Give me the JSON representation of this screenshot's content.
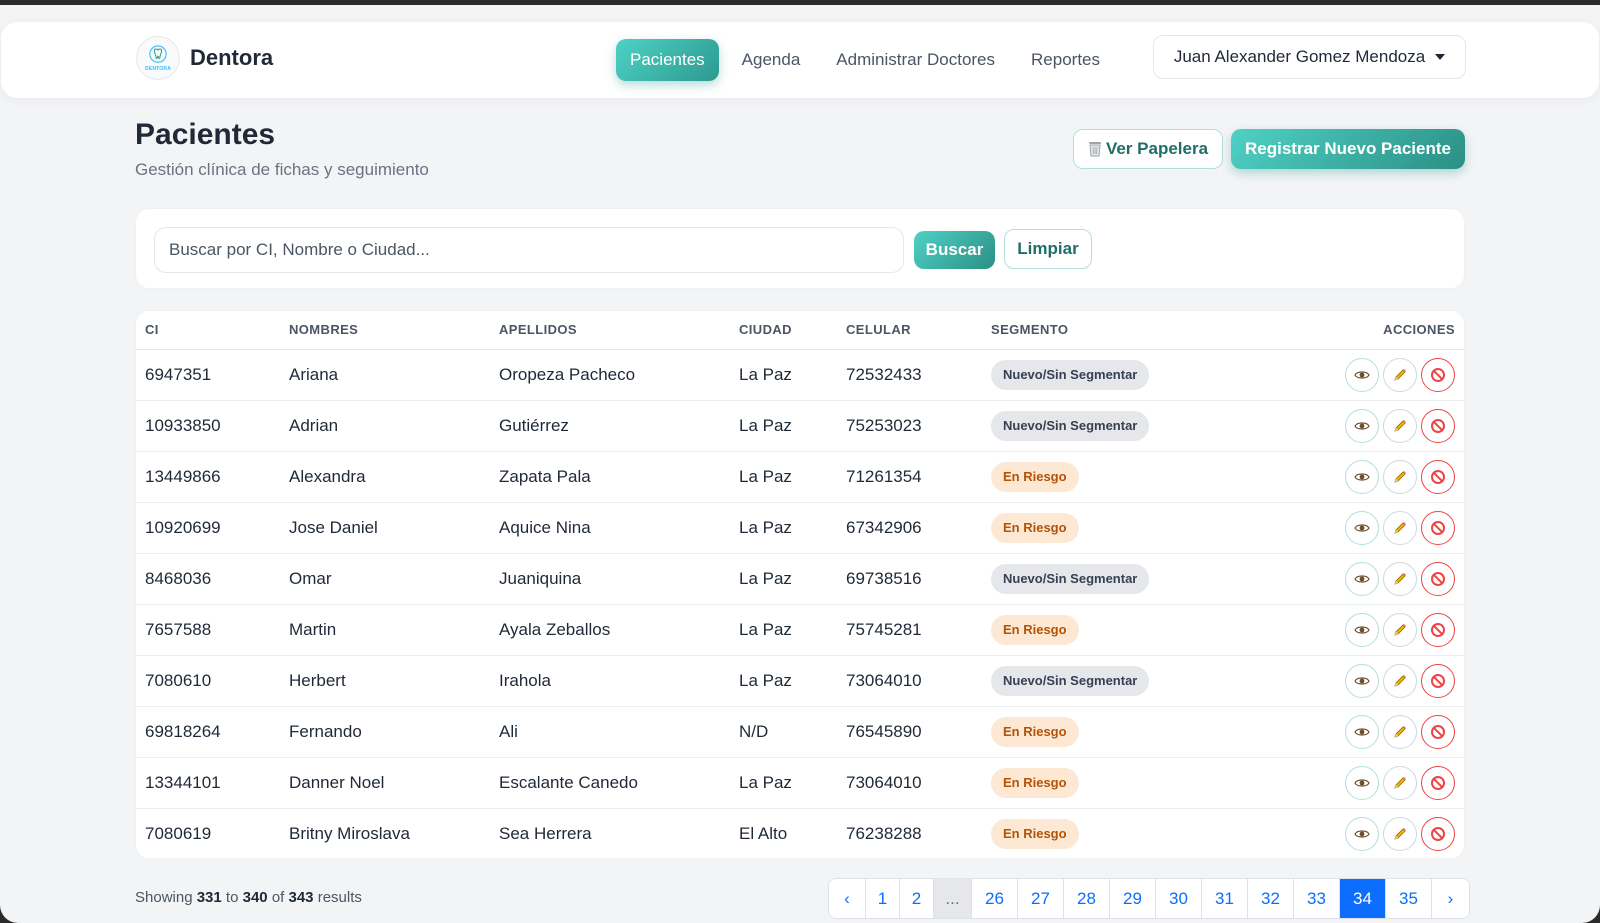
{
  "brand": {
    "name": "Dentora",
    "logo_text": "DENTORA"
  },
  "nav": {
    "links": [
      "Pacientes",
      "Agenda",
      "Administrar Doctores",
      "Reportes"
    ],
    "user": "Juan Alexander Gomez Mendoza"
  },
  "header": {
    "title": "Pacientes",
    "subtitle": "Gestión clínica de fichas y seguimiento",
    "trash_button": "Ver Papelera",
    "register_button": "Registrar Nuevo Paciente"
  },
  "search": {
    "placeholder": "Buscar por CI, Nombre o Ciudad...",
    "value": "",
    "search_button": "Buscar",
    "clear_button": "Limpiar"
  },
  "table": {
    "columns": [
      "CI",
      "NOMBRES",
      "APELLIDOS",
      "CIUDAD",
      "CELULAR",
      "SEGMENTO",
      "ACCIONES"
    ],
    "rows": [
      {
        "ci": "6947351",
        "nombres": "Ariana",
        "apellidos": "Oropeza Pacheco",
        "ciudad": "La Paz",
        "celular": "72532433",
        "segmento": "Nuevo/Sin Segmentar"
      },
      {
        "ci": "10933850",
        "nombres": "Adrian",
        "apellidos": "Gutiérrez",
        "ciudad": "La Paz",
        "celular": "75253023",
        "segmento": "Nuevo/Sin Segmentar"
      },
      {
        "ci": "13449866",
        "nombres": "Alexandra",
        "apellidos": "Zapata Pala",
        "ciudad": "La Paz",
        "celular": "71261354",
        "segmento": "En Riesgo"
      },
      {
        "ci": "10920699",
        "nombres": "Jose Daniel",
        "apellidos": "Aquice Nina",
        "ciudad": "La Paz",
        "celular": "67342906",
        "segmento": "En Riesgo"
      },
      {
        "ci": "8468036",
        "nombres": "Omar",
        "apellidos": "Juaniquina",
        "ciudad": "La Paz",
        "celular": "69738516",
        "segmento": "Nuevo/Sin Segmentar"
      },
      {
        "ci": "7657588",
        "nombres": "Martin",
        "apellidos": "Ayala Zeballos",
        "ciudad": "La Paz",
        "celular": "75745281",
        "segmento": "En Riesgo"
      },
      {
        "ci": "7080610",
        "nombres": "Herbert",
        "apellidos": "Irahola",
        "ciudad": "La Paz",
        "celular": "73064010",
        "segmento": "Nuevo/Sin Segmentar"
      },
      {
        "ci": "69818264",
        "nombres": "Fernando",
        "apellidos": "Ali",
        "ciudad": "N/D",
        "celular": "76545890",
        "segmento": "En Riesgo"
      },
      {
        "ci": "13344101",
        "nombres": "Danner Noel",
        "apellidos": "Escalante Canedo",
        "ciudad": "La Paz",
        "celular": "73064010",
        "segmento": "En Riesgo"
      },
      {
        "ci": "7080619",
        "nombres": "Britny Miroslava",
        "apellidos": "Sea Herrera",
        "ciudad": "El Alto",
        "celular": "76238288",
        "segmento": "En Riesgo"
      }
    ],
    "action_icons": [
      "eye-icon",
      "pencil-icon",
      "block-icon"
    ]
  },
  "pagination": {
    "summary": {
      "prefix": "Showing",
      "from": "331",
      "to_word": "to",
      "to": "340",
      "of_word": "of",
      "total": "343",
      "suffix": "results"
    },
    "prev": "‹",
    "next": "›",
    "pages": [
      "1",
      "2",
      "...",
      "26",
      "27",
      "28",
      "29",
      "30",
      "31",
      "32",
      "33",
      "34",
      "35"
    ],
    "current": "34"
  },
  "colors": {
    "accent": "#3cb8ad",
    "accent_dark": "#2c8f85",
    "badge_neutral_bg": "#e5e7eb",
    "badge_risk_bg": "#fde9d3",
    "badge_risk_text": "#b45309",
    "danger": "#ef4444",
    "link_blue": "#0d6efd"
  }
}
